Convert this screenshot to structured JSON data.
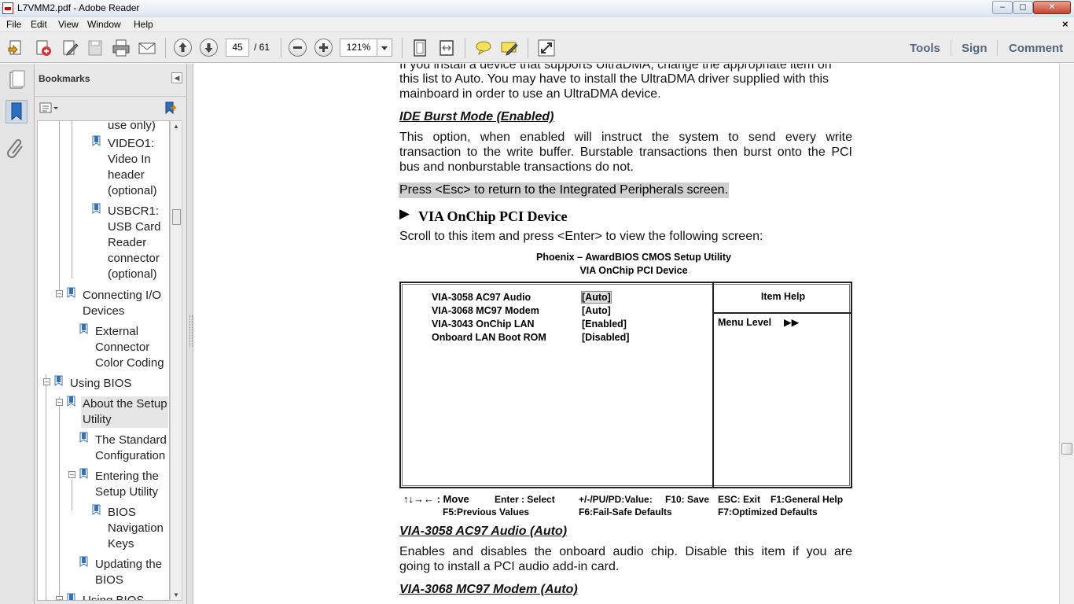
{
  "window": {
    "title": "L7VMM2.pdf - Adobe Reader"
  },
  "menu": [
    "File",
    "Edit",
    "View",
    "Window",
    "Help"
  ],
  "toolbar": {
    "page_current": "45",
    "page_total": "/ 61",
    "zoom": "121%",
    "links": [
      "Tools",
      "Sign",
      "Comment"
    ]
  },
  "bookmarks": {
    "title": "Bookmarks",
    "items": [
      {
        "label_lines": [
          "use only)"
        ]
      },
      {
        "label_lines": [
          "VIDEO1:",
          "Video In",
          "header",
          "(optional)"
        ]
      },
      {
        "label_lines": [
          "USBCR1:",
          "USB Card",
          "Reader",
          "connector",
          "(optional)"
        ]
      },
      {
        "label_lines": [
          "Connecting I/O",
          "Devices"
        ]
      },
      {
        "label_lines": [
          "External",
          "Connector",
          "Color Coding"
        ]
      },
      {
        "label_lines": [
          "Using BIOS"
        ]
      },
      {
        "label_lines": [
          "About the Setup",
          "Utility"
        ]
      },
      {
        "label_lines": [
          "The Standard",
          "Configuration"
        ]
      },
      {
        "label_lines": [
          "Entering the",
          "Setup Utility"
        ]
      },
      {
        "label_lines": [
          "BIOS",
          "Navigation",
          "Keys"
        ]
      },
      {
        "label_lines": [
          "Updating the",
          "BIOS"
        ]
      },
      {
        "label_lines": [
          "Using BIOS"
        ]
      }
    ]
  },
  "document": {
    "para_top_cut": "If you install a device that supports UltraDMA, change the appropriate item on",
    "para1_l2": "this list to Auto. You may have to install the UltraDMA driver supplied with this",
    "para1_l3": "mainboard in order to use an UltraDMA device.",
    "heading_burst": "IDE Burst Mode (Enabled)",
    "burst_l1": "This option, when enabled will instruct the system to send every write",
    "burst_l2": "transaction to the write buffer. Burstable transactions then burst onto the PCI",
    "burst_l3": "bus and nonburstable transactions do not.",
    "press_esc": "Press <Esc> to return to the Integrated Peripherals screen.",
    "section_title": "VIA OnChip PCI Device",
    "section_marker": "▶",
    "scroll_text": "Scroll to this item and press <Enter> to view the following screen:",
    "bios_caption_1": "Phoenix – AwardBIOS CMOS Setup Utility",
    "bios_caption_2": "VIA OnChip PCI Device",
    "bios_rows": [
      {
        "name": "VIA-3058 AC97 Audio",
        "value": "[Auto]"
      },
      {
        "name": "VIA-3068 MC97 Modem",
        "value": "[Auto]"
      },
      {
        "name": "VIA-3043 OnChip LAN",
        "value": "[Enabled]"
      },
      {
        "name": "Onboard LAN Boot ROM",
        "value": "[Disabled]"
      }
    ],
    "bios_help_title": "Item Help",
    "bios_menu_level": "Menu Level",
    "bios_menu_level_arrows": "▶▶",
    "bios_keys": {
      "move": "↑↓→← : Move",
      "enter": "Enter : Select",
      "value": "+/-/PU/PD:Value:",
      "f10": "F10: Save",
      "esc": "ESC: Exit",
      "f1": "F1:General Help",
      "f5": "F5:Previous Values",
      "f6": "F6:Fail-Safe Defaults",
      "f7": "F7:Optimized Defaults"
    },
    "heading_audio": "VIA-3058 AC97 Audio (Auto)",
    "audio_l1": "Enables and disables the onboard audio chip. Disable this item if you are",
    "audio_l2": "going to install a PCI audio add-in card.",
    "heading_modem": "VIA-3068 MC97 Modem (Auto)"
  },
  "colors": {
    "accent": "#55667a",
    "highlight": "#cfcfcf"
  }
}
